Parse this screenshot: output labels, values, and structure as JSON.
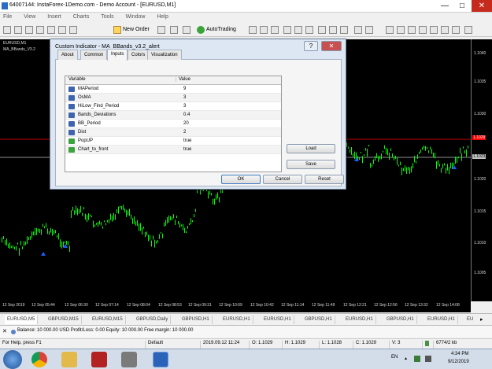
{
  "window": {
    "title": "64007144: InstaForex-1Demo.com - Demo Account - [EURUSD,M1]",
    "minimize": "—",
    "maximize": "□",
    "close": "✕"
  },
  "menu": [
    "File",
    "View",
    "Insert",
    "Charts",
    "Tools",
    "Window",
    "Help"
  ],
  "toolbar": {
    "new_order": "New Order",
    "autotrading": "AutoTrading"
  },
  "chart": {
    "symbol_label": "EURUSD,M1",
    "indicator_label": "MA_BBands_V3.2",
    "bid_price": "1.1029",
    "ask_price": "1.1023",
    "price_ticks": [
      "1.1040",
      "1.1035",
      "1.1030",
      "1.1025",
      "1.1020",
      "1.1015",
      "1.1010",
      "1.1005"
    ],
    "time_ticks": [
      "12 Sep 2019",
      "12 Sep 05:44",
      "12 Sep 06:30",
      "12 Sep 07:14",
      "12 Sep 08:04",
      "12 Sep 08:53",
      "12 Sep 09:31",
      "12 Sep 10:09",
      "12 Sep 10:42",
      "12 Sep 11:14",
      "12 Sep 11:49",
      "12 Sep 12:21",
      "12 Sep 12:56",
      "12 Sep 13:32",
      "12 Sep 14:08"
    ],
    "colors": {
      "background": "#000000",
      "bars": "#00ff00",
      "arrows": "#1e5bff",
      "bid_line": "#ff0000",
      "ask_line": "#c0c0c0"
    }
  },
  "chart_tabs": [
    "EURUSD,M5",
    "GBPUSD,M15",
    "EURUSD,M15",
    "GBPUSD,Daily",
    "GBPUSD,H1",
    "EURUSD,H1",
    "EURUSD,H1",
    "GBPUSD,H1",
    "EURUSD,H1",
    "GBPUSD,H1",
    "EURUSD,H1",
    "GBPUSD,H1",
    "EURUSD,H1",
    "EURUSD,H1",
    "GBPUSD,H1",
    "EURUSD,H1",
    "EU"
  ],
  "terminal": {
    "balance_text": "Balance: 10 000.00 USD  Profit/Loss: 0.00  Equity: 10 000.00  Free margin: 10 000.00"
  },
  "status": {
    "help": "For Help, press F1",
    "profile": "Default",
    "datetime": "2019.09.12 11:24",
    "open": "O: 1.1029",
    "high": "H: 1.1029",
    "low": "L: 1.1028",
    "close": "C: 1.1029",
    "volume": "V: 3",
    "traffic": "6774/2 kb"
  },
  "taskbar": {
    "lang": "EN",
    "time": "4:34 PM",
    "date": "9/12/2019"
  },
  "dialog": {
    "title": "Custom Indicator - MA_BBands_v3.2_alert",
    "help_btn": "?",
    "close_btn": "✕",
    "tabs": [
      "About",
      "Common",
      "Inputs",
      "Colors",
      "Visualization"
    ],
    "active_tab": "Inputs",
    "columns": {
      "variable": "Variable",
      "value": "Value"
    },
    "rows": [
      {
        "name": "MAPeriod",
        "value": "9",
        "type": "num"
      },
      {
        "name": "OsMA",
        "value": "3",
        "type": "num"
      },
      {
        "name": "HiLow_Find_Period",
        "value": "3",
        "type": "num"
      },
      {
        "name": "Bands_Deviations",
        "value": "0.4",
        "type": "num"
      },
      {
        "name": "BB_Period",
        "value": "20",
        "type": "num"
      },
      {
        "name": "Dist",
        "value": "2",
        "type": "num"
      },
      {
        "name": "PopUP",
        "value": "true",
        "type": "bool"
      },
      {
        "name": "Chart_to_front",
        "value": "true",
        "type": "bool"
      }
    ],
    "load": "Load",
    "save": "Save",
    "ok": "OK",
    "cancel": "Cancel",
    "reset": "Reset"
  }
}
